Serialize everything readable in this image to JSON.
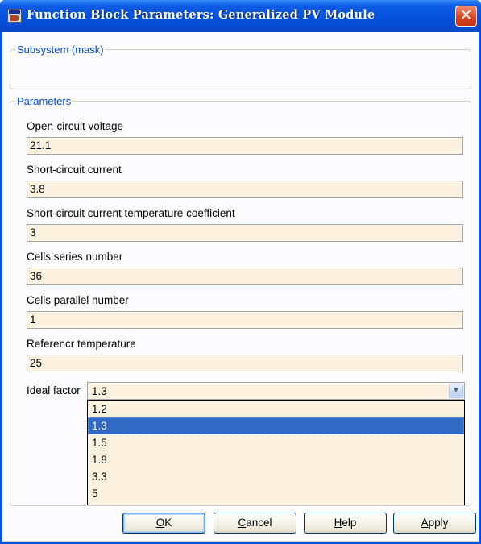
{
  "window": {
    "title": "Function Block Parameters: Generalized PV Module",
    "close_glyph": "✕"
  },
  "subsystem": {
    "legend": "Subsystem (mask)"
  },
  "parameters": {
    "legend": "Parameters",
    "fields": [
      {
        "label": "Open-circuit voltage",
        "value": "21.1"
      },
      {
        "label": "Short-circuit current",
        "value": "3.8"
      },
      {
        "label": "Short-circuit current temperature coefficient",
        "value": "3"
      },
      {
        "label": "Cells series number",
        "value": "36"
      },
      {
        "label": "Cells parallel number",
        "value": "1"
      },
      {
        "label": "Referencr temperature",
        "value": "25"
      }
    ],
    "ideal_factor": {
      "label": "Ideal factor",
      "value": "1.3",
      "options": [
        "1.2",
        "1.3",
        "1.5",
        "1.8",
        "3.3",
        "5"
      ],
      "selected_index": 1
    }
  },
  "buttons": {
    "ok": {
      "accel": "O",
      "rest": "K"
    },
    "cancel": {
      "accel": "C",
      "rest": "ancel"
    },
    "help": {
      "accel": "H",
      "rest": "elp"
    },
    "apply": {
      "accel": "A",
      "rest": "pply"
    }
  },
  "colors": {
    "titlebar": "#0550db",
    "field_bg": "#fdf1df",
    "selection": "#316ac5",
    "group_legend": "#0046d5"
  }
}
